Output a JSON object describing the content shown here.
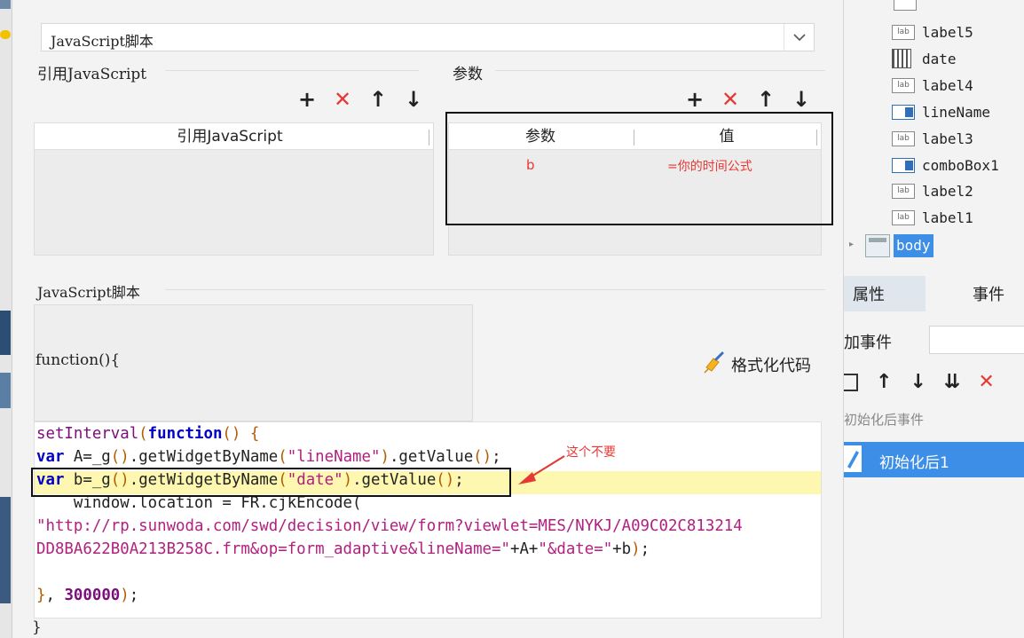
{
  "script_type_select": {
    "value": "JavaScript脚本"
  },
  "ref_section": {
    "title": "引用JavaScript",
    "column_header": "引用JavaScript",
    "toolbar": {
      "add": "+",
      "delete": "✕",
      "up": "↑",
      "down": "↓"
    }
  },
  "params_section": {
    "title": "参数",
    "columns": [
      "参数",
      "值"
    ],
    "rows": [
      {
        "param": "b",
        "value": "=你的时间公式"
      }
    ],
    "toolbar": {
      "add": "+",
      "delete": "✕",
      "up": "↑",
      "down": "↓"
    }
  },
  "script_section": {
    "title": "JavaScript脚本",
    "function_header": "function(){",
    "format_button": "格式化代码",
    "code_lines": [
      "setInterval(function() {",
      "var A=_g().getWidgetByName(\"lineName\").getValue();",
      "var b=_g().getWidgetByName(\"date\").getValue();",
      "    window.location = FR.cjkEncode(",
      "\"http://rp.sunwoda.com/swd/decision/view/form?viewlet=MES/NYKJ/A09C02C813214",
      "DD8BA622B0A213B258C.frm&op=form_adaptive&lineName=\"+A+\"&date=\"+b);",
      "",
      "}, 300000);"
    ],
    "closing_brace": "}",
    "annotation": "这个不要"
  },
  "widget_tree": {
    "items": [
      {
        "label": "label5",
        "icon": "label-icon"
      },
      {
        "label": "date",
        "icon": "date-icon"
      },
      {
        "label": "label4",
        "icon": "label-icon"
      },
      {
        "label": "lineName",
        "icon": "combo-icon"
      },
      {
        "label": "label3",
        "icon": "label-icon"
      },
      {
        "label": "comboBox1",
        "icon": "combo-icon"
      },
      {
        "label": "label2",
        "icon": "label-icon"
      },
      {
        "label": "label1",
        "icon": "label-icon"
      }
    ],
    "body_label": "body"
  },
  "right_panel": {
    "tabs": [
      "属性",
      "事件"
    ],
    "add_event_label": "加事件",
    "event_group_label": "初始化后事件",
    "selected_event": "初始化后1"
  },
  "colors": {
    "accent_blue": "#3d8ee6",
    "delete_red": "#e53935",
    "highlight_yellow": "#fdf7b0"
  }
}
